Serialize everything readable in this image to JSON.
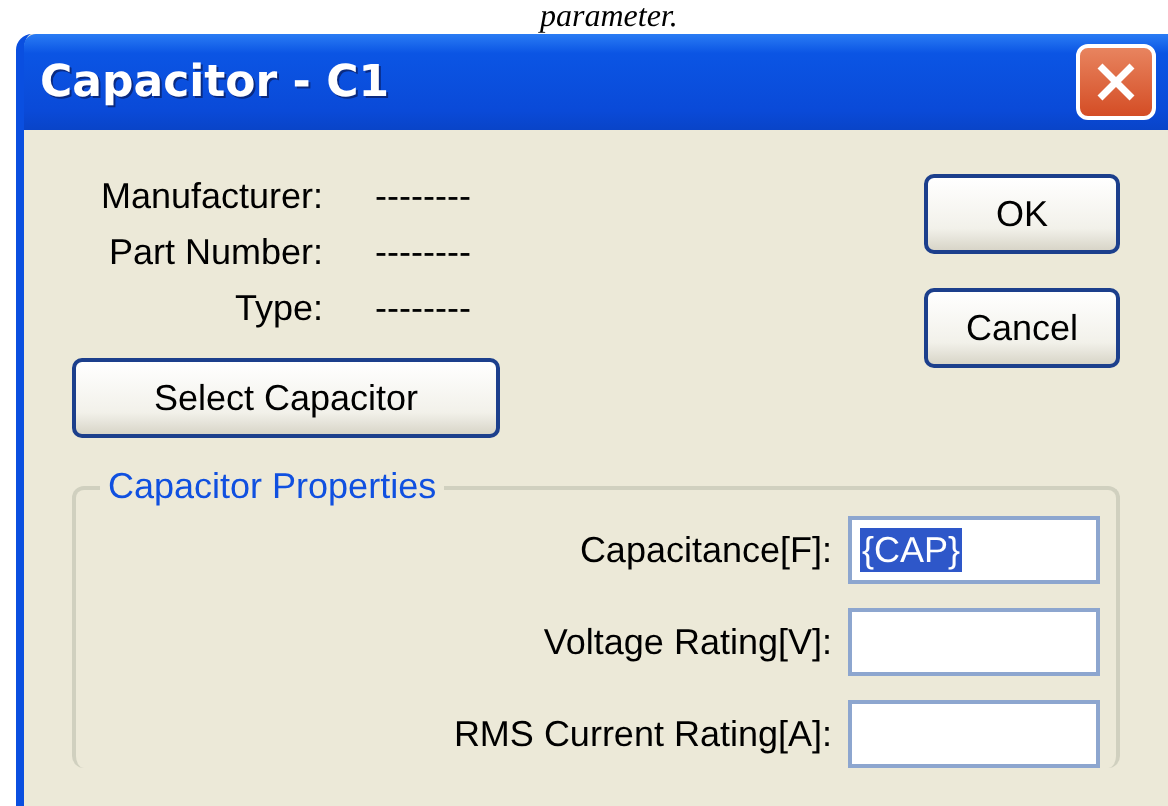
{
  "document_text": "parameter.",
  "window": {
    "title": "Capacitor - C1"
  },
  "info": [
    {
      "label": "Manufacturer:",
      "value": "--------"
    },
    {
      "label": "Part Number:",
      "value": "--------"
    },
    {
      "label": "Type:",
      "value": "--------"
    }
  ],
  "select_button": "Select Capacitor",
  "buttons": [
    "OK",
    "Cancel"
  ],
  "group": {
    "title": "Capacitor Properties",
    "fields": [
      {
        "label": "Capacitance[F]:",
        "value": "{CAP}",
        "highlighted": true
      },
      {
        "label": "Voltage Rating[V]:"
      },
      {
        "label": "RMS Current Rating[A]:"
      }
    ]
  }
}
